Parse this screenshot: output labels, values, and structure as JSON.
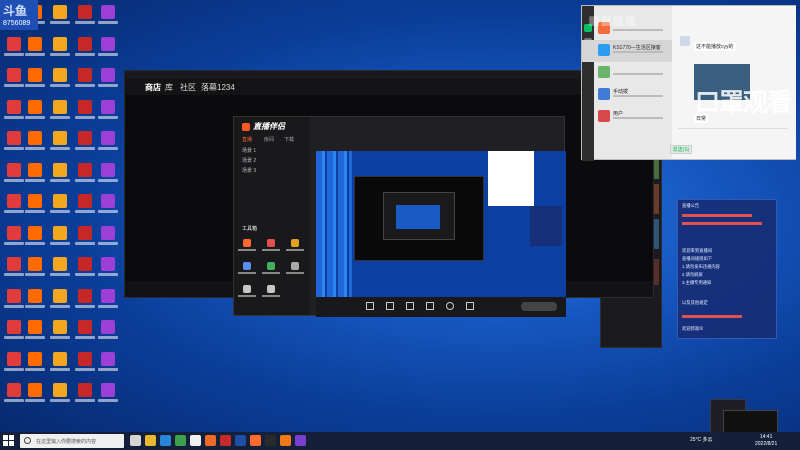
{
  "desktop": {
    "corner_badge": {
      "logo": "斗鱼",
      "id_text": "8756089"
    }
  },
  "main_window": {
    "nav": {
      "store": "商店",
      "library": "库",
      "community": "社区",
      "user": "落幕1234"
    }
  },
  "inner_window": {
    "logo": "直播伴侣",
    "tabs": [
      "直播",
      "房间",
      "下载"
    ],
    "scene_rows": [
      "场景 1",
      "场景 2",
      "场景 3"
    ],
    "tools_title": "工具箱"
  },
  "chat_window": {
    "contacts": [
      {
        "name": "",
        "color": "#f36b3b"
      },
      {
        "name": "KS1770—生活区接客",
        "color": "#2b9cf0"
      },
      {
        "name": "",
        "color": "#6bb36b"
      },
      {
        "name": "手动拨",
        "color": "#3d7bd6"
      },
      {
        "name": "用户",
        "color": "#d94848"
      }
    ],
    "messages": [
      "这不能播放cyy的",
      "日常"
    ],
    "send_label": "发送(S)"
  },
  "watermark": {
    "text": "口罩观看"
  },
  "info_panel": {
    "lines": [
      "直播公告",
      "欢迎来到直播间",
      "直播间规则如下",
      "1.请勿发布违规内容",
      "2.请勿刷屏",
      "3.主播专用通知",
      "以及其他规定",
      "欢迎新观众"
    ]
  },
  "taskbar": {
    "search_placeholder": "在这里输入你要搜索的内容",
    "tray_text": "25°C 多云",
    "clock_time": "14:41",
    "clock_date": "2022/8/21"
  },
  "colors": {
    "desktop_bg": "#1659c2",
    "accent_orange": "#ff6a2f",
    "wechat_green": "#07c160"
  }
}
